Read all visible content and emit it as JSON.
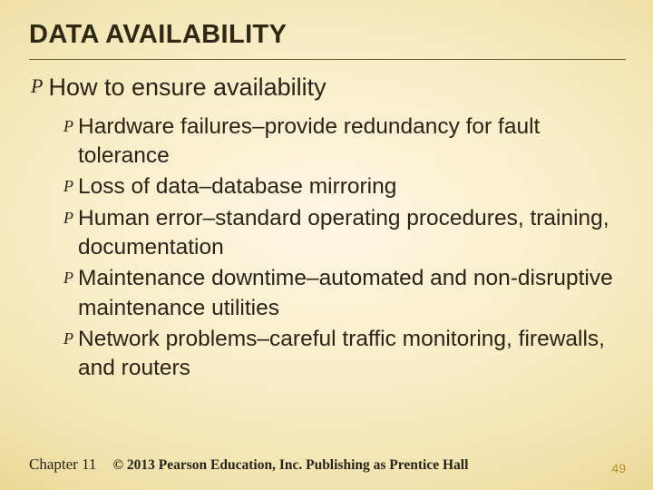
{
  "title": "DATA AVAILABILITY",
  "level1": {
    "text": "How to ensure availability",
    "sub": [
      "Hardware failures–provide redundancy for fault tolerance",
      "Loss of data–database mirroring",
      "Human error–standard operating procedures, training, documentation",
      "Maintenance downtime–automated and non-disruptive maintenance utilities",
      "Network problems–careful traffic monitoring, firewalls, and routers"
    ]
  },
  "footer": {
    "chapter": "Chapter 11",
    "copyright": "© 2013 Pearson Education, Inc.  Publishing as Prentice Hall",
    "page": "49"
  },
  "glyph": "P"
}
